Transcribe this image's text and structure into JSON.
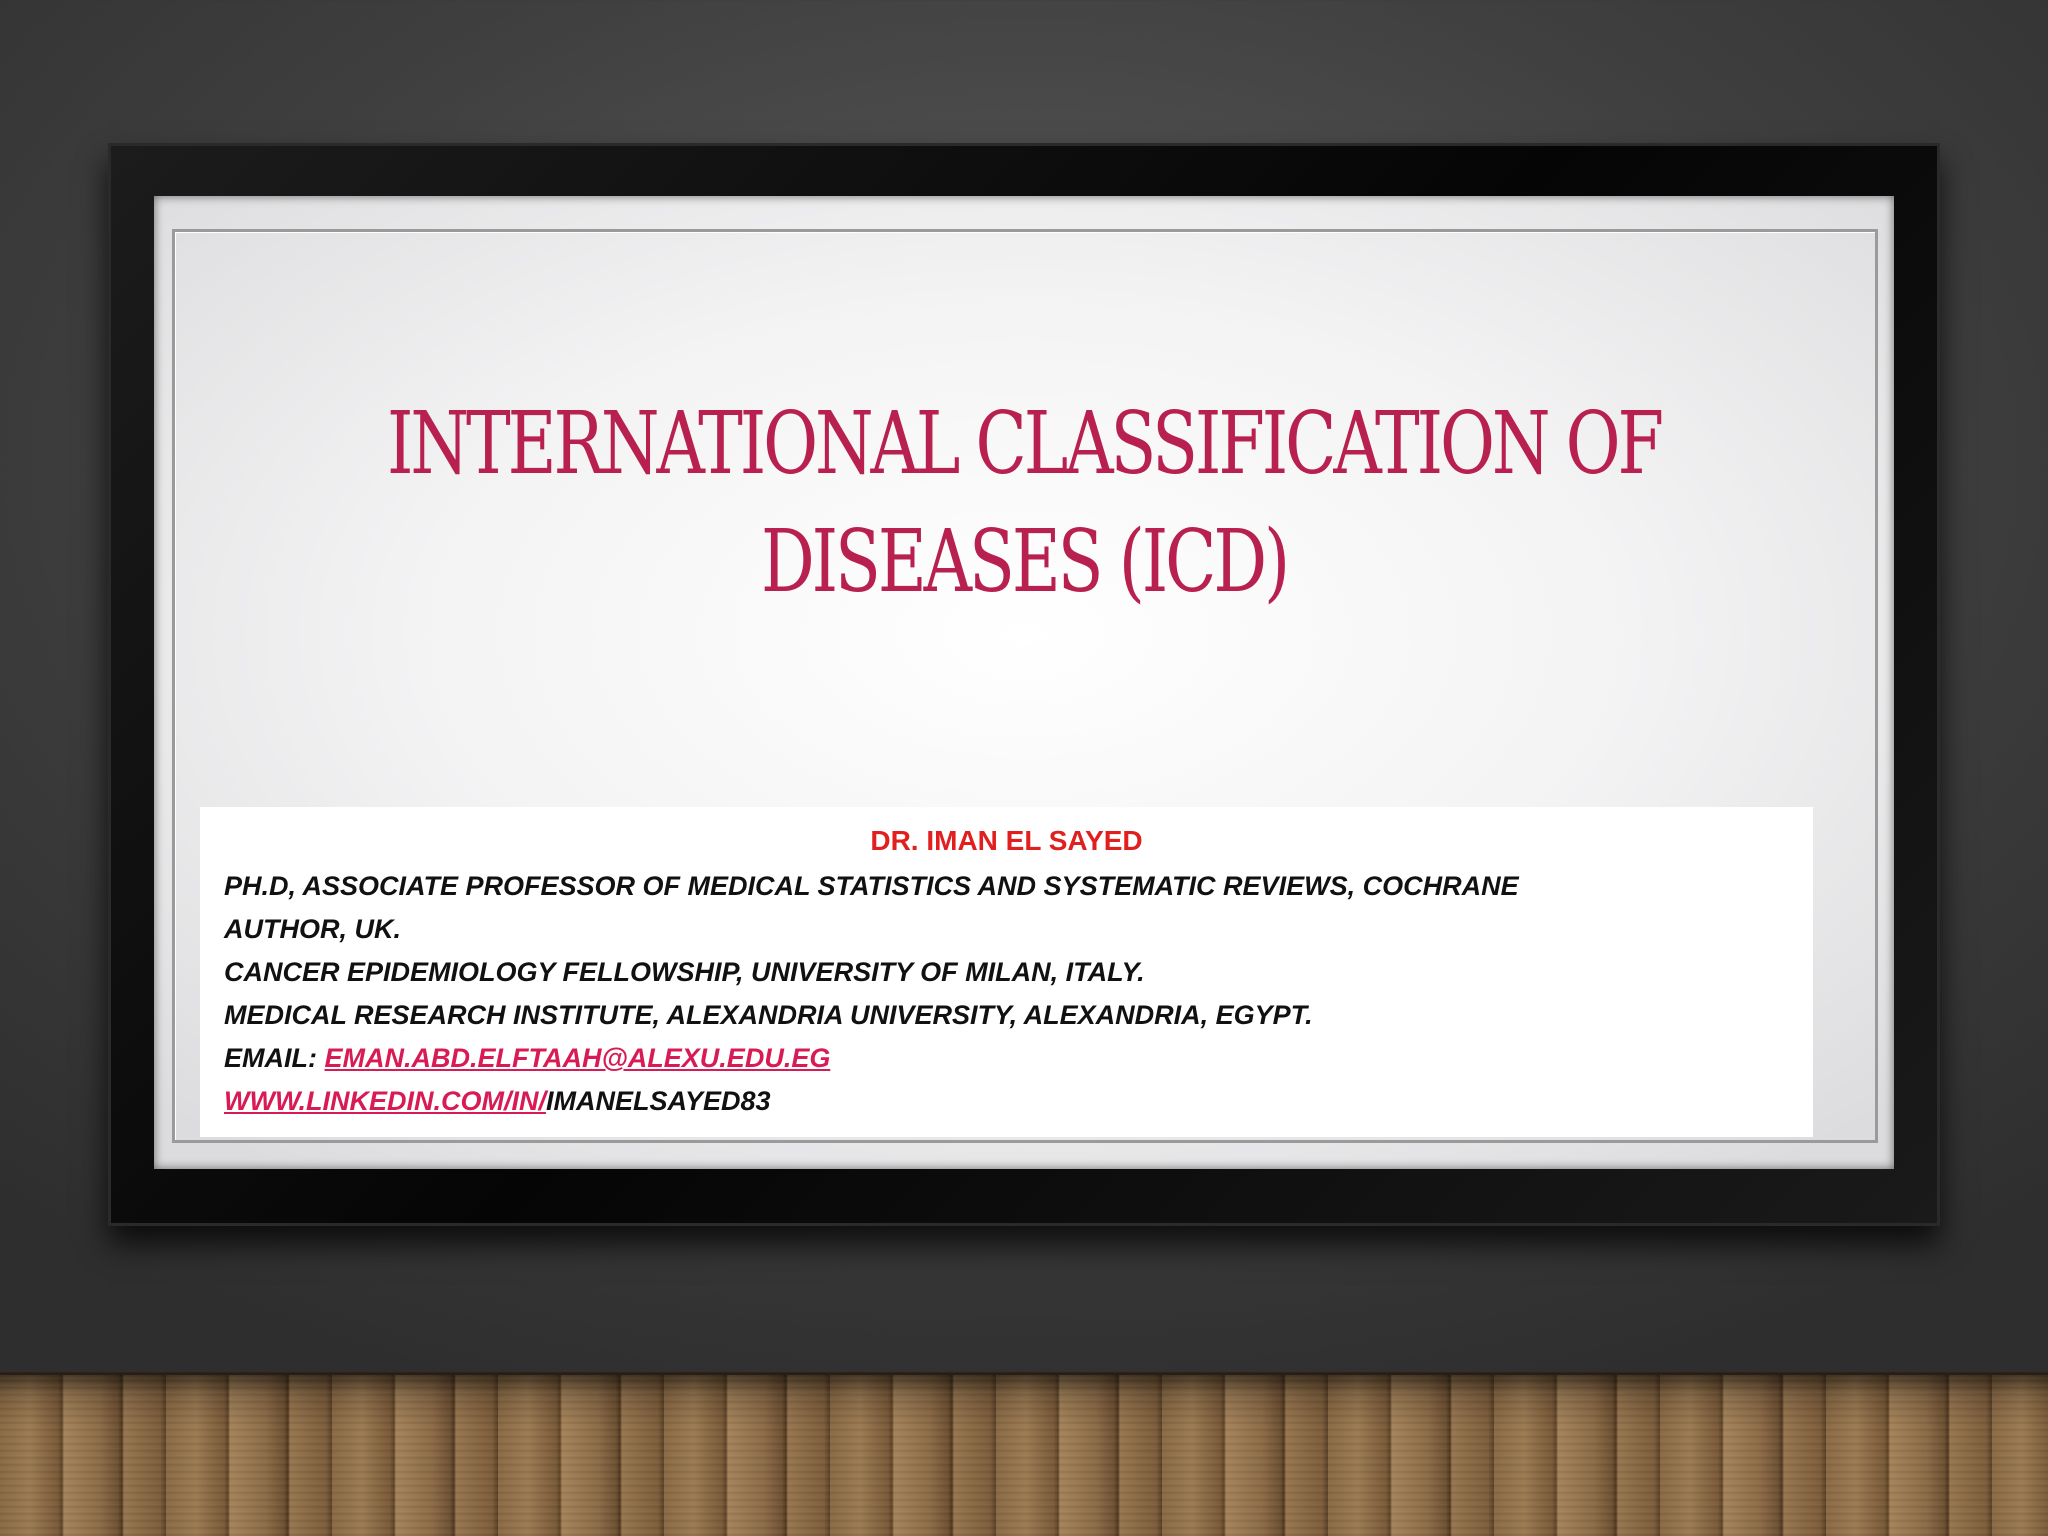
{
  "slide": {
    "title_line1": "INTERNATIONAL CLASSIFICATION OF",
    "title_line2": "DISEASES (ICD)"
  },
  "author": {
    "name": "DR. IMAN EL SAYED",
    "line1": "PH.D, ASSOCIATE PROFESSOR OF  MEDICAL STATISTICS AND SYSTEMATIC REVIEWS, COCHRANE",
    "line2": "AUTHOR, UK.",
    "line3": "CANCER EPIDEMIOLOGY FELLOWSHIP, UNIVERSITY OF MILAN, ITALY.",
    "line4": "MEDICAL RESEARCH INSTITUTE, ALEXANDRIA UNIVERSITY, ALEXANDRIA, EGYPT.",
    "email_label": "EMAIL: ",
    "email": "EMAN.ABD.ELFTAAH@ALEXU.EDU.EG",
    "linkedin_link": "WWW.LINKEDIN.COM/IN/",
    "linkedin_suffix": "IMANELSAYED83"
  },
  "colors": {
    "title": "#b8204f",
    "author_name": "#e0201f",
    "link": "#d81b55"
  }
}
